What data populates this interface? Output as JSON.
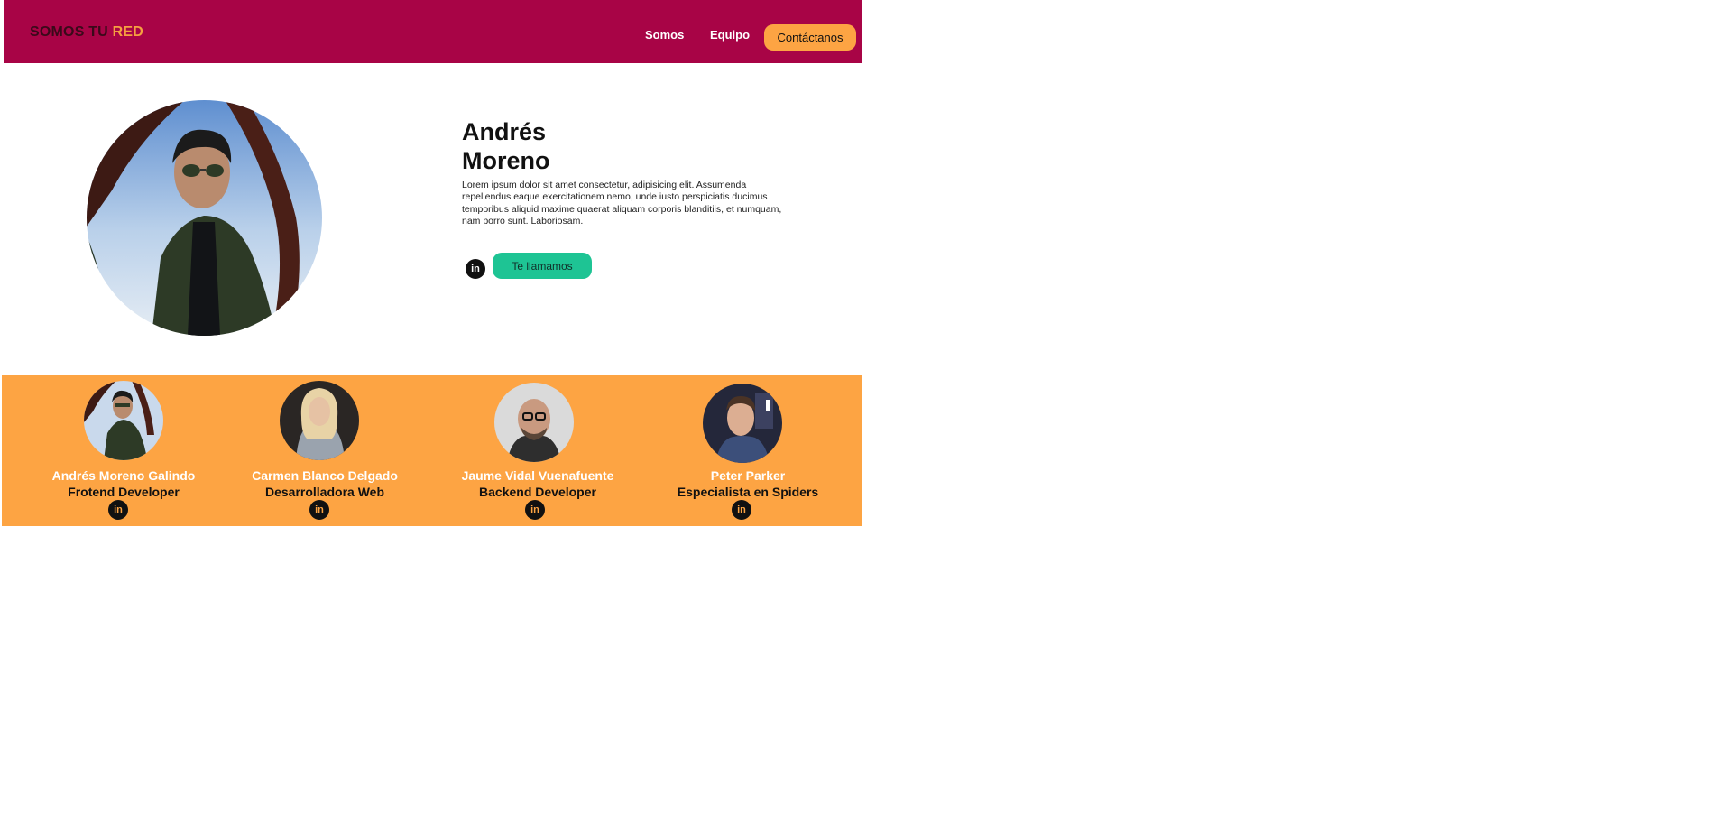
{
  "header": {
    "logo_part1": "SOMOS TU",
    "logo_part2": "RED",
    "nav": [
      {
        "label": "Somos"
      },
      {
        "label": "Equipo"
      }
    ],
    "cta_label": "Contáctanos",
    "background_color": "#a80446",
    "accent_color": "#fda443"
  },
  "hero": {
    "first_name": "Andrés",
    "last_name": "Moreno",
    "description": "Lorem ipsum dolor sit amet consectetur, adipisicing elit. Assumenda repellendus eaque exercitationem nemo, unde iusto perspiciatis ducimus temporibus aliquid maxime  quaerat aliquam corporis blanditiis, et numquam, nam porro sunt.  Laboriosam.",
    "linkedin_icon_text": "in",
    "callback_label": "Te llamamos",
    "callback_color": "#1ec494"
  },
  "team": {
    "background_color": "#fda443",
    "members": [
      {
        "name": "Andrés Moreno Galindo",
        "role": "Frotend Developer",
        "linkedin_icon_text": "in"
      },
      {
        "name": "Carmen Blanco Delgado",
        "role": "Desarrolladora Web",
        "linkedin_icon_text": "in"
      },
      {
        "name": "Jaume Vidal Vuenafuente",
        "role": "Backend Developer",
        "linkedin_icon_text": "in"
      },
      {
        "name": "Peter Parker",
        "role": "Especialista en Spiders",
        "linkedin_icon_text": "in"
      }
    ]
  }
}
